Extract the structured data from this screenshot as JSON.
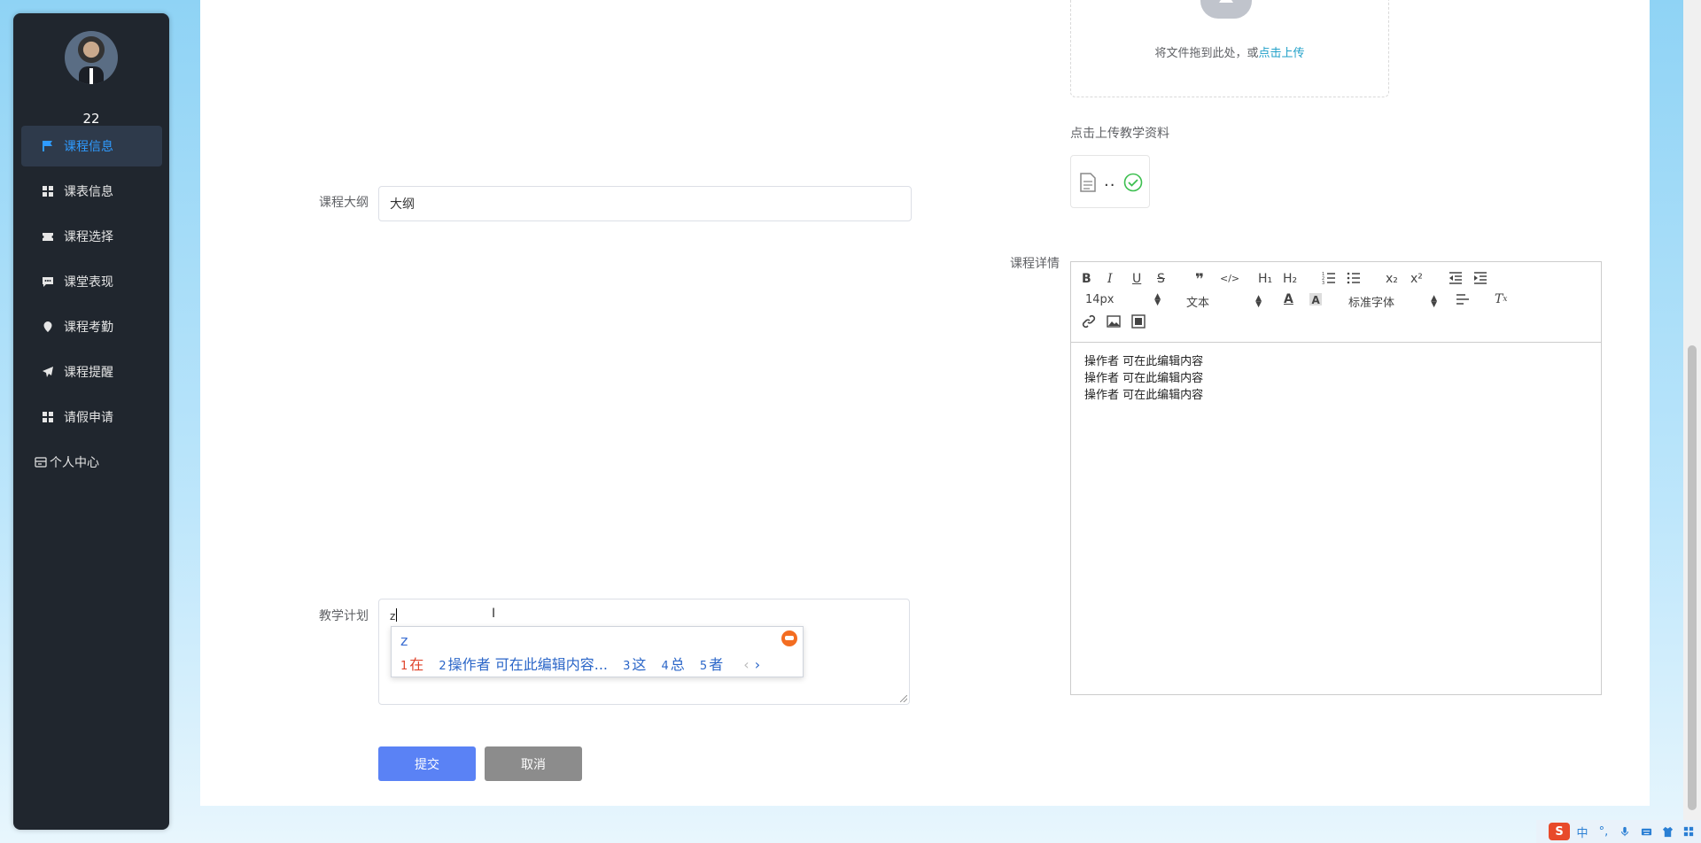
{
  "user": {
    "name": "22"
  },
  "sidebar": {
    "items": [
      {
        "label": "课程信息",
        "icon": "flag-icon",
        "active": true
      },
      {
        "label": "课表信息",
        "icon": "grid-icon"
      },
      {
        "label": "课程选择",
        "icon": "ticket-icon"
      },
      {
        "label": "课堂表现",
        "icon": "comment-icon"
      },
      {
        "label": "课程考勤",
        "icon": "map-pin-icon"
      },
      {
        "label": "课程提醒",
        "icon": "send-icon"
      },
      {
        "label": "请假申请",
        "icon": "grid-icon"
      },
      {
        "label": "个人中心",
        "icon": "card-icon"
      }
    ]
  },
  "form": {
    "syllabus": {
      "label": "课程大纲",
      "value": "大纲"
    },
    "plan": {
      "label": "教学计划",
      "value": "z"
    },
    "details": {
      "label": "课程详情"
    },
    "submit_label": "提交",
    "cancel_label": "取消"
  },
  "upload": {
    "hint": "将文件拖到此处，或",
    "link": "点击上传",
    "tip": "点击上传教学资料",
    "file_name": ".."
  },
  "editor": {
    "font_size": "14px",
    "block_type": "文本",
    "font_family": "标准字体",
    "lines": [
      "操作者  可在此编辑内容",
      "操作者  可在此编辑内容",
      "操作者  可在此编辑内容"
    ]
  },
  "ime": {
    "composition": "z",
    "candidates": [
      {
        "n": "1",
        "text": "在"
      },
      {
        "n": "2",
        "text": "操作者  可在此编辑内容..."
      },
      {
        "n": "3",
        "text": "这"
      },
      {
        "n": "4",
        "text": "总"
      },
      {
        "n": "5",
        "text": "者"
      }
    ]
  },
  "tray": {
    "ime_lang": "中",
    "punct": "°,"
  }
}
